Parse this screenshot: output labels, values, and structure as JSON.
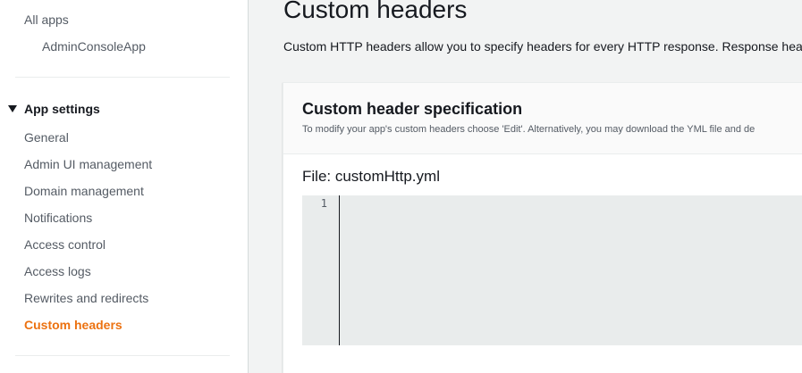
{
  "sidebar": {
    "all_apps": "All apps",
    "app_name": "AdminConsoleApp",
    "section_title": "App settings",
    "items": [
      {
        "label": "General"
      },
      {
        "label": "Admin UI management"
      },
      {
        "label": "Domain management"
      },
      {
        "label": "Notifications"
      },
      {
        "label": "Access control"
      },
      {
        "label": "Access logs"
      },
      {
        "label": "Rewrites and redirects"
      },
      {
        "label": "Custom headers"
      }
    ],
    "active_item": "Custom headers"
  },
  "main": {
    "title": "Custom headers",
    "description": "Custom HTTP headers allow you to specify headers for every HTTP response. Response hea",
    "panel": {
      "title": "Custom header specification",
      "description": "To modify your app's custom headers choose 'Edit'. Alternatively, you may download the YML file and de",
      "file_label": "File: customHttp.yml",
      "editor": {
        "line_numbers": [
          "1"
        ],
        "content": ""
      }
    }
  },
  "colors": {
    "active_link": "#ec7211",
    "text": "#16191f",
    "secondary_text": "#545b64",
    "content_background": "#f2f3f3",
    "editor_background": "#e9ecec"
  },
  "icons": {
    "section_toggle": "caret-down-icon"
  }
}
